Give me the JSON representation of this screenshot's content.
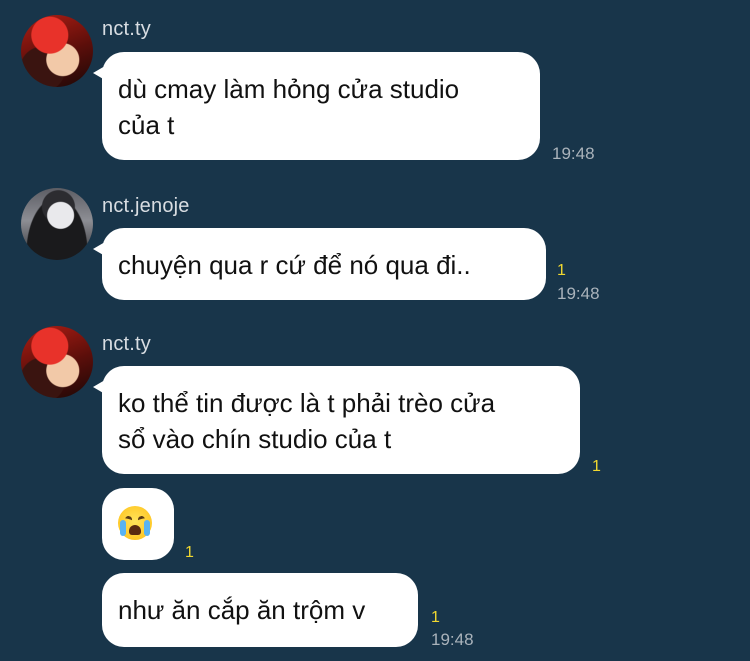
{
  "colors": {
    "background": "#18354a",
    "bubble": "#ffffff",
    "read_indicator": "#f1d830",
    "timestamp": "#aab3bb"
  },
  "messages": [
    {
      "sender": "nct.ty",
      "text_line1": "dù cmay làm hỏng cửa studio",
      "text_line2": "của t",
      "time": "19:48"
    },
    {
      "sender": "nct.jenoje",
      "text_line1": "chuyện qua r cứ để nó qua đi..",
      "read_count": "1",
      "time": "19:48"
    },
    {
      "sender": "nct.ty",
      "text_line1": "ko thể tin được là t phải trèo cửa",
      "text_line2": "sổ vào chín studio của t",
      "read_count": "1"
    },
    {
      "sticker": "loudly-crying-face-emoji",
      "read_count": "1"
    },
    {
      "text_line1": "như ăn cắp ăn trộm v",
      "read_count": "1",
      "time": "19:48"
    }
  ]
}
